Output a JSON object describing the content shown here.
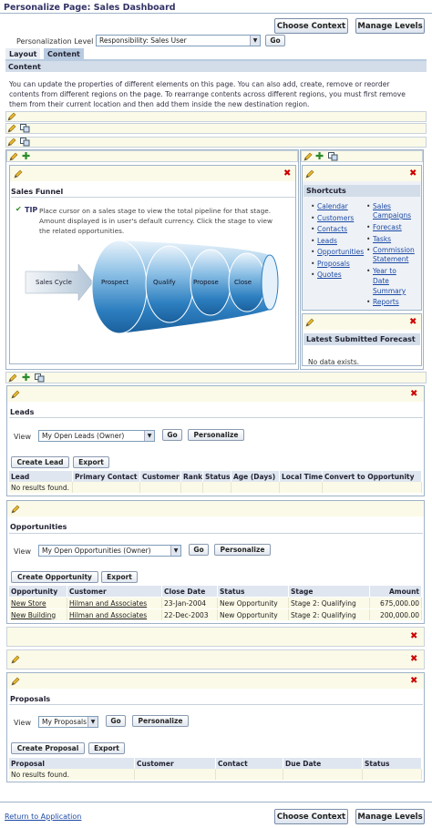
{
  "page": {
    "title": "Personalize Page: Sales Dashboard",
    "choose_context": "Choose Context",
    "manage_levels": "Manage Levels",
    "personalization_level_label": "Personalization Level",
    "personalization_level_value": "Responsibility: Sales User",
    "go": "Go",
    "tabs": [
      "Layout",
      "Content"
    ],
    "section_title": "Content",
    "intro": "You can update the properties of different elements on this page. You can also add, create, remove or reorder contents from different regions on the page. To rearrange contents across different regions, you must first remove them from their current location and then add them inside the new destination region.",
    "return_link": "Return to Application"
  },
  "sales_funnel": {
    "title": "Sales Funnel",
    "tip_label": "TIP",
    "tip_text_1": "Place cursor on a sales stage to view the total pipeline for that stage.",
    "tip_text_2": "Amount displayed is in user's default currency. Click the stage to view",
    "tip_text_3": "the related opportunities.",
    "arrow_label": "Sales Cycle",
    "stages": [
      "Prospect",
      "Qualify",
      "Propose",
      "Close"
    ]
  },
  "shortcuts": {
    "title": "Shortcuts",
    "col1": [
      "Calendar",
      "Customers",
      "Contacts",
      "Leads",
      "Opportunities",
      "Proposals",
      "Quotes"
    ],
    "col2": [
      "Sales",
      "Campaigns",
      "Forecast",
      "Tasks",
      "Commission",
      "Statement",
      "Year to",
      "Date",
      "Summary",
      "Reports"
    ]
  },
  "forecast": {
    "title": "Latest Submitted Forecast",
    "empty": "No data exists."
  },
  "leads": {
    "title": "Leads",
    "view_label": "View",
    "view_value": "My Open Leads (Owner)",
    "go": "Go",
    "personalize": "Personalize",
    "create": "Create Lead",
    "export": "Export",
    "columns": [
      "Lead",
      "Primary Contact",
      "Customer",
      "Rank",
      "Status",
      "Age (Days)",
      "Local Time",
      "Convert to Opportunity"
    ],
    "empty": "No results found."
  },
  "opportunities": {
    "title": "Opportunities",
    "view_label": "View",
    "view_value": "My Open Opportunities (Owner)",
    "go": "Go",
    "personalize": "Personalize",
    "create": "Create Opportunity",
    "export": "Export",
    "columns": [
      "Opportunity",
      "Customer",
      "Close Date",
      "Status",
      "Stage",
      "Amount"
    ],
    "rows": [
      {
        "opportunity": "New Store",
        "customer": "Hilman and Associates",
        "close_date": "23-Jan-2004",
        "status": "New Opportunity",
        "stage": "Stage 2: Qualifying",
        "amount": "675,000.00"
      },
      {
        "opportunity": "New Building",
        "customer": "Hilman and Associates",
        "close_date": "22-Dec-2003",
        "status": "New Opportunity",
        "stage": "Stage 2: Qualifying",
        "amount": "200,000.00"
      }
    ]
  },
  "proposals": {
    "title": "Proposals",
    "view_label": "View",
    "view_value": "My Proposals",
    "go": "Go",
    "personalize": "Personalize",
    "create": "Create Proposal",
    "export": "Export",
    "columns": [
      "Proposal",
      "Customer",
      "Contact",
      "Due Date",
      "Status"
    ],
    "empty": "No results found."
  }
}
